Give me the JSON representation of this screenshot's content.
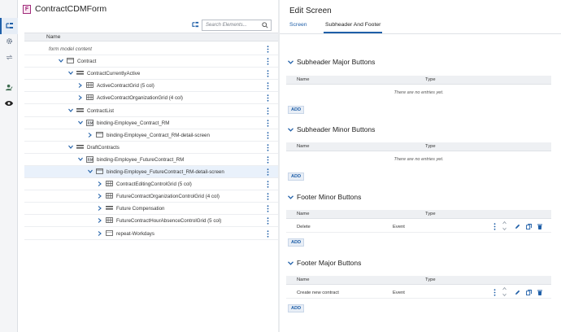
{
  "form": {
    "badge": "F",
    "title": "ContractCDMForm"
  },
  "tree": {
    "search_placeholder": "Search Elements...",
    "column_name": "Name",
    "rows": [
      {
        "label": "form model content",
        "italic": true
      },
      {
        "label": "Contract"
      },
      {
        "label": "ContractCurrentlyActive"
      },
      {
        "label": "ActiveContractGrid (5 col)"
      },
      {
        "label": "ActiveContractOrganizationGrid (4 col)"
      },
      {
        "label": "ContractList"
      },
      {
        "label": "binding-Employee_Contract_RM"
      },
      {
        "label": "binding-Employee_Contract_RM-detail-screen"
      },
      {
        "label": "DraftContracts"
      },
      {
        "label": "binding-Employee_FutureContract_RM"
      },
      {
        "label": "binding-Employee_FutureContract_RM-detail-screen"
      },
      {
        "label": "ContractEditingControlGrid (5 col)"
      },
      {
        "label": "FutureContractOrganizationControlGrid (4 col)"
      },
      {
        "label": "Future Compensation"
      },
      {
        "label": "FutureContractHourAbsenceControlGrid (5 col)"
      },
      {
        "label": "repeat-Workdays"
      }
    ]
  },
  "edit": {
    "title": "Edit Screen",
    "tabs": [
      "Screen",
      "Subheader And Footer"
    ],
    "col_name": "Name",
    "col_type": "Type",
    "empty_text": "There are no entries yet.",
    "add_label": "ADD",
    "sections": [
      {
        "title": "Subheader Major Buttons"
      },
      {
        "title": "Subheader Minor Buttons"
      },
      {
        "title": "Footer Minor Buttons",
        "row": {
          "name": "Delete",
          "type": "Event"
        }
      },
      {
        "title": "Footer Major Buttons",
        "row": {
          "name": "Create new contract",
          "type": "Event"
        }
      }
    ]
  },
  "colors": {
    "accent": "#1f5fa8",
    "badge": "#a02a7a"
  },
  "icons": [
    "tree-icon",
    "gear-icon",
    "arrows-icon",
    "person-icon",
    "eye-icon",
    "search-icon",
    "chevron-down-icon",
    "chevron-right-icon",
    "kebab-icon",
    "edit-icon",
    "copy-icon",
    "delete-icon"
  ]
}
